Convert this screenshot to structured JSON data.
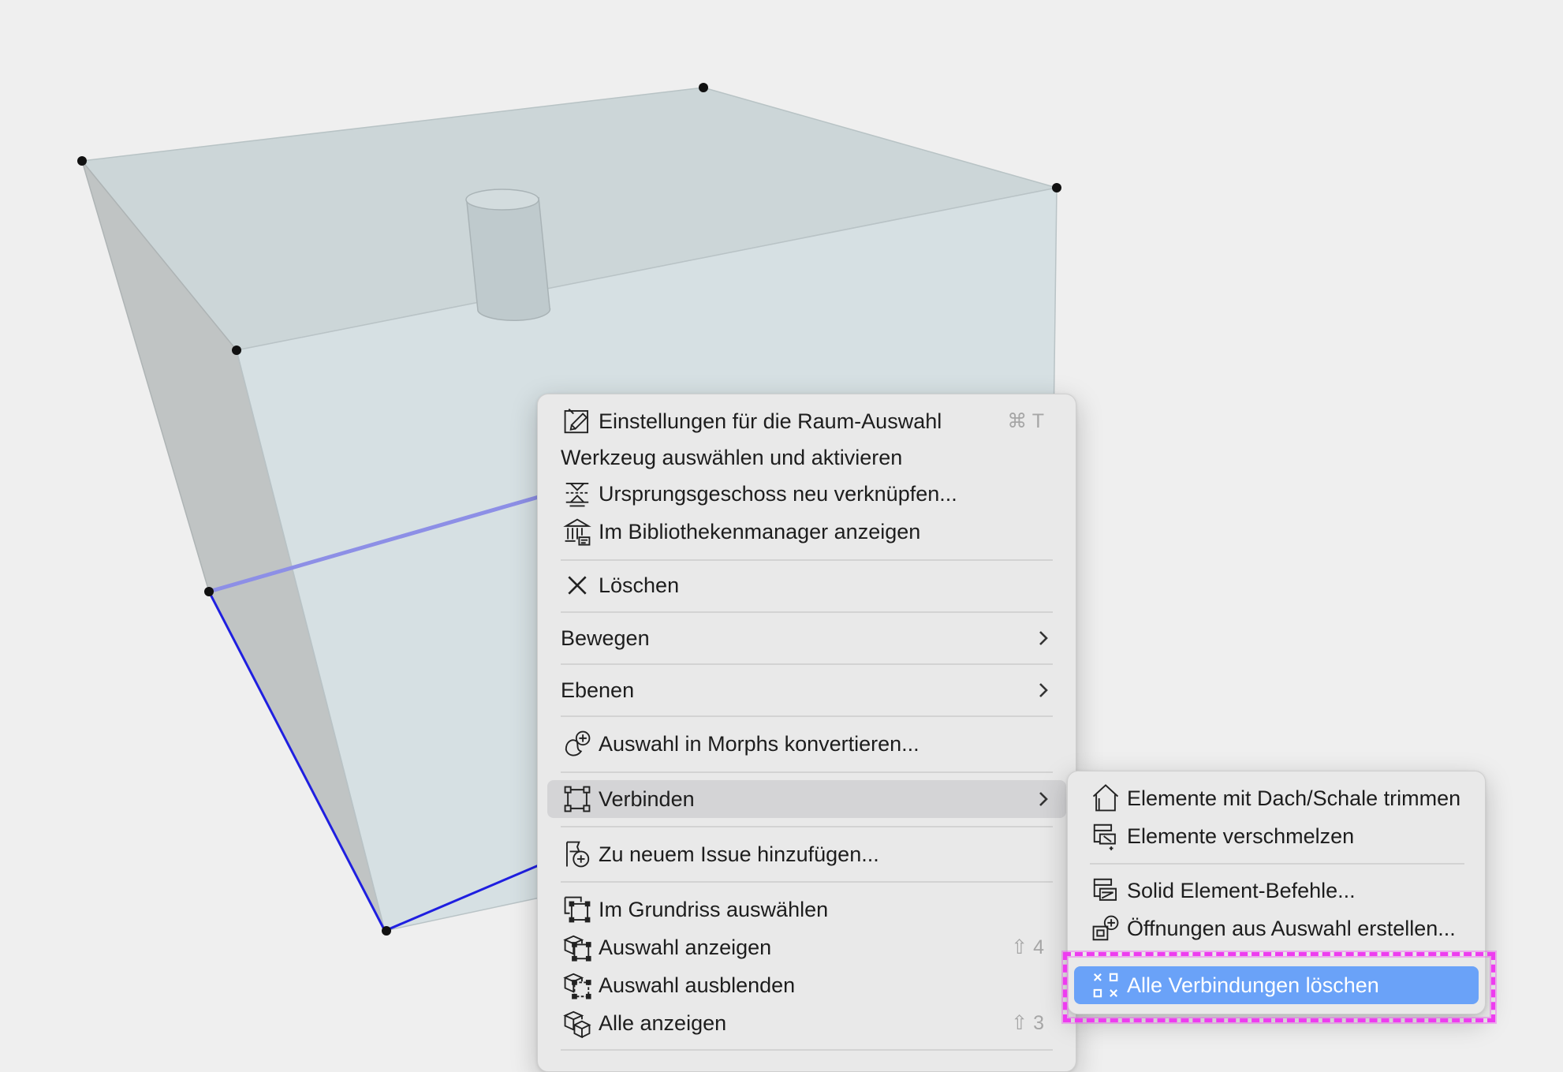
{
  "colors": {
    "menu_background": "#e9e9e9",
    "hover": "#d4d4d6",
    "selected": "#6aa2f8",
    "highlight": "#ee3cf0",
    "edge_selected": "#1f1fe0"
  },
  "context_menu": {
    "items": [
      {
        "label": "Einstellungen für die Raum-Auswahl",
        "icon": "settings-pencil-icon",
        "shortcut": "⌘ T"
      },
      {
        "label": "Werkzeug auswählen und aktivieren"
      },
      {
        "label": "Ursprungsgeschoss neu verknüpfen...",
        "icon": "relink-story-icon"
      },
      {
        "label": "Im Bibliothekenmanager anzeigen",
        "icon": "library-icon"
      },
      {
        "label": "Löschen",
        "icon": "close-icon"
      },
      {
        "label": "Bewegen",
        "submenu": true
      },
      {
        "label": "Ebenen",
        "submenu": true
      },
      {
        "label": "Auswahl in Morphs konvertieren...",
        "icon": "morph-icon"
      },
      {
        "label": "Verbinden",
        "icon": "connect-icon",
        "submenu": true,
        "state": "hover"
      },
      {
        "label": "Zu neuem Issue hinzufügen...",
        "icon": "issue-add-icon"
      },
      {
        "label": "Im Grundriss auswählen",
        "icon": "select-in-plan-icon"
      },
      {
        "label": "Auswahl anzeigen",
        "icon": "show-selection-icon",
        "shortcut": "⇧ 4"
      },
      {
        "label": "Auswahl ausblenden",
        "icon": "hide-selection-icon"
      },
      {
        "label": "Alle anzeigen",
        "icon": "show-all-icon",
        "shortcut": "⇧ 3"
      }
    ]
  },
  "submenu": {
    "items": [
      {
        "label": "Elemente mit Dach/Schale trimmen",
        "icon": "trim-roof-icon"
      },
      {
        "label": "Elemente verschmelzen",
        "icon": "merge-icon"
      },
      {
        "label": "Solid Element-Befehle...",
        "icon": "solid-operations-icon"
      },
      {
        "label": "Öffnungen aus Auswahl erstellen...",
        "icon": "create-opening-icon"
      },
      {
        "label": "Alle Verbindungen löschen",
        "icon": "remove-connections-icon",
        "state": "selected"
      }
    ]
  }
}
